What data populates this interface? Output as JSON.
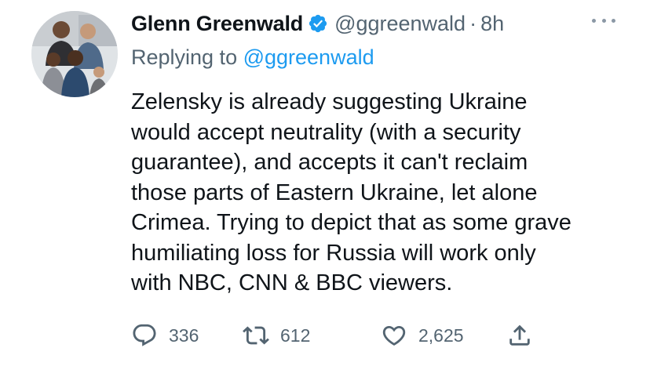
{
  "tweet": {
    "display_name": "Glenn Greenwald",
    "handle": "@ggreenwald",
    "separator": "·",
    "time": "8h",
    "verified": true,
    "replying_prefix": "Replying to ",
    "replying_to": "@ggreenwald",
    "text_lines": [
      "Zelensky is already suggesting Ukraine",
      "would accept neutrality (with a security",
      "guarantee), and accepts it can't reclaim",
      "those parts of Eastern Ukraine, let alone",
      "Crimea. Trying to depict that as some grave",
      "humiliating loss for Russia will work only",
      "with NBC, CNN & BBC viewers."
    ],
    "actions": {
      "replies": "336",
      "retweets": "612",
      "likes": "2,625"
    }
  },
  "colors": {
    "text": "#0f1419",
    "secondary": "#536471",
    "link": "#1d9bf0",
    "verified_badge": "#1d9bf0"
  },
  "icons": {
    "more": "more-horizontal-icon",
    "verified": "verified-badge-icon",
    "reply": "reply-bubble-icon",
    "retweet": "retweet-icon",
    "like": "heart-icon",
    "share": "share-upload-icon"
  }
}
